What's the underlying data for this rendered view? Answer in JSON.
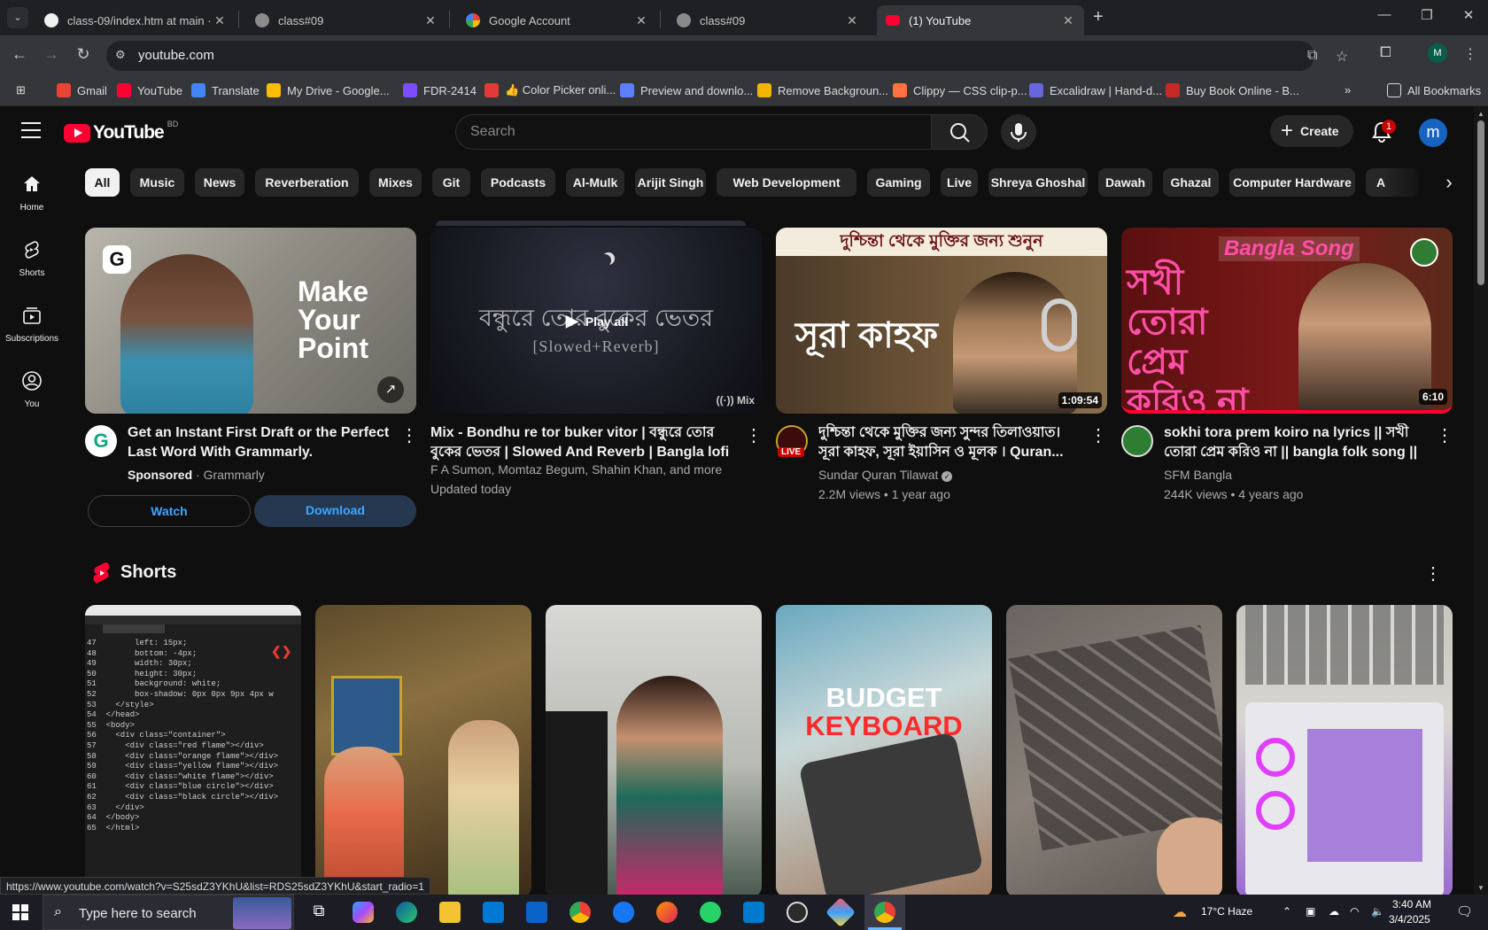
{
  "browser": {
    "tabs": [
      {
        "title": "class-09/index.htm at main · M",
        "favicon": "github-icon"
      },
      {
        "title": "class#09",
        "favicon": "globe-icon"
      },
      {
        "title": "Google Account",
        "favicon": "google-icon"
      },
      {
        "title": "class#09",
        "favicon": "globe-icon"
      },
      {
        "title": "(1) YouTube",
        "favicon": "youtube-icon",
        "active": true
      }
    ],
    "url": "youtube.com",
    "profile_initial": "M",
    "bookmarks": [
      {
        "label": "Gmail",
        "color": "#ea4335"
      },
      {
        "label": "YouTube",
        "color": "#ff0033"
      },
      {
        "label": "Translate",
        "color": "#4285f4"
      },
      {
        "label": "My Drive - Google...",
        "color": "#fbbc04"
      },
      {
        "label": "FDR-2414",
        "color": "#7c4dff"
      },
      {
        "label": "👍 Color Picker onli...",
        "color": "#e53935"
      },
      {
        "label": "Preview and downlo...",
        "color": "#5b7fff"
      },
      {
        "label": "Remove Backgroun...",
        "color": "#f2b600"
      },
      {
        "label": "Clippy — CSS clip-p...",
        "color": "#ff7043"
      },
      {
        "label": "Excalidraw | Hand-d...",
        "color": "#6965db"
      },
      {
        "label": "Buy Book Online - B...",
        "color": "#c62828"
      }
    ],
    "all_bookmarks": "All Bookmarks",
    "overflow": "»"
  },
  "youtube": {
    "logo_text": "YouTube",
    "country_code": "BD",
    "search_placeholder": "Search",
    "create_label": "Create",
    "notification_count": "1",
    "avatar_initial": "m",
    "guide": [
      {
        "label": "Home",
        "icon": "home-icon"
      },
      {
        "label": "Shorts",
        "icon": "shorts-icon"
      },
      {
        "label": "Subscriptions",
        "icon": "subscriptions-icon"
      },
      {
        "label": "You",
        "icon": "you-icon"
      }
    ],
    "chips": [
      "All",
      "Music",
      "News",
      "Reverberation",
      "Mixes",
      "Git",
      "Podcasts",
      "Al-Mulk",
      "Arijit Singh",
      "Web Development",
      "Gaming",
      "Live",
      "Shreya Ghoshal",
      "Dawah",
      "Ghazal",
      "Computer Hardware",
      "A"
    ],
    "videos": [
      {
        "title": "Get an Instant First Draft or the Perfect Last Word With Grammarly.",
        "sponsored": "Sponsored",
        "channel": "Grammarly",
        "thumb_text": "Make Your Point",
        "watch": "Watch",
        "download": "Download"
      },
      {
        "title": "Mix - Bondhu re tor buker vitor | বন্ধুরে তোর বুকের ভেতর | Slowed And Reverb | Bangla lofi song",
        "artists": "F A Sumon, Momtaz Begum, Shahin Khan, and more",
        "updated": "Updated today",
        "thumb_line1": "বন্ধুরে তোর বুকের ভেতর",
        "thumb_line2": "[Slowed+Reverb]",
        "play_all": "Play all",
        "mix_badge": "Mix"
      },
      {
        "title": "দুশ্চিন্তা থেকে মুক্তির জন্য সুন্দর তিলাওয়াত। সূরা কাহফ, সূরা ইয়াসিন ও মূলক । Quran...",
        "channel": "Sundar Quran Tilawat",
        "views": "2.2M views",
        "age": "1 year ago",
        "duration": "1:09:54",
        "thumb_banner": "দুশ্চিন্তা থেকে মুক্তির জন্য শুনুন",
        "thumb_title": "সূরা কাহফ",
        "live": "LIVE"
      },
      {
        "title": "sokhi tora prem koiro na lyrics || সখী তোরা প্রেম করিও না || bangla folk song || SFM...",
        "channel": "SFM Bangla",
        "views": "244K views",
        "age": "4 years ago",
        "duration": "6:10",
        "thumb_tag": "Bangla Song",
        "thumb_text": "সখী তোরা প্রেম করিও না"
      }
    ],
    "shorts_title": "Shorts",
    "shorts": [
      {
        "name": "code-editor"
      },
      {
        "name": "film-scene"
      },
      {
        "name": "drama-scene"
      },
      {
        "name": "budget-keyboard",
        "text1": "BUDGET",
        "text2": "KEYBOARD"
      },
      {
        "name": "laptop-keyboard"
      },
      {
        "name": "pc-build"
      }
    ],
    "code_lines": [
      "47        left: 15px;",
      "48        bottom: -4px;",
      "49        width: 30px;",
      "50        height: 30px;",
      "51        background: white;",
      "52        box-shadow: 0px 0px 9px 4px w",
      "53    </style>",
      "54  </head>",
      "55  <body>",
      "56    <div class=\"container\">",
      "57      <div class=\"red flame\"></div>",
      "58      <div class=\"orange flame\"></div>",
      "59      <div class=\"yellow flame\"></div>",
      "60      <div class=\"white flame\"></div>",
      "61      <div class=\"blue circle\"></div>",
      "62      <div class=\"black circle\"></div>",
      "63    </div>",
      "64  </body>",
      "65  </html>"
    ]
  },
  "status_url": "https://www.youtube.com/watch?v=S25sdZ3YKhU&list=RDS25sdZ3YKhU&start_radio=1",
  "taskbar": {
    "search_placeholder": "Type here to search",
    "weather": "17°C  Haze",
    "time": "3:40 AM",
    "date": "3/4/2025"
  },
  "colors": {
    "yt_bg": "#0f0f0f",
    "chip_bg": "#272727",
    "brand_red": "#ff0033",
    "link_blue": "#3ea6ff"
  }
}
